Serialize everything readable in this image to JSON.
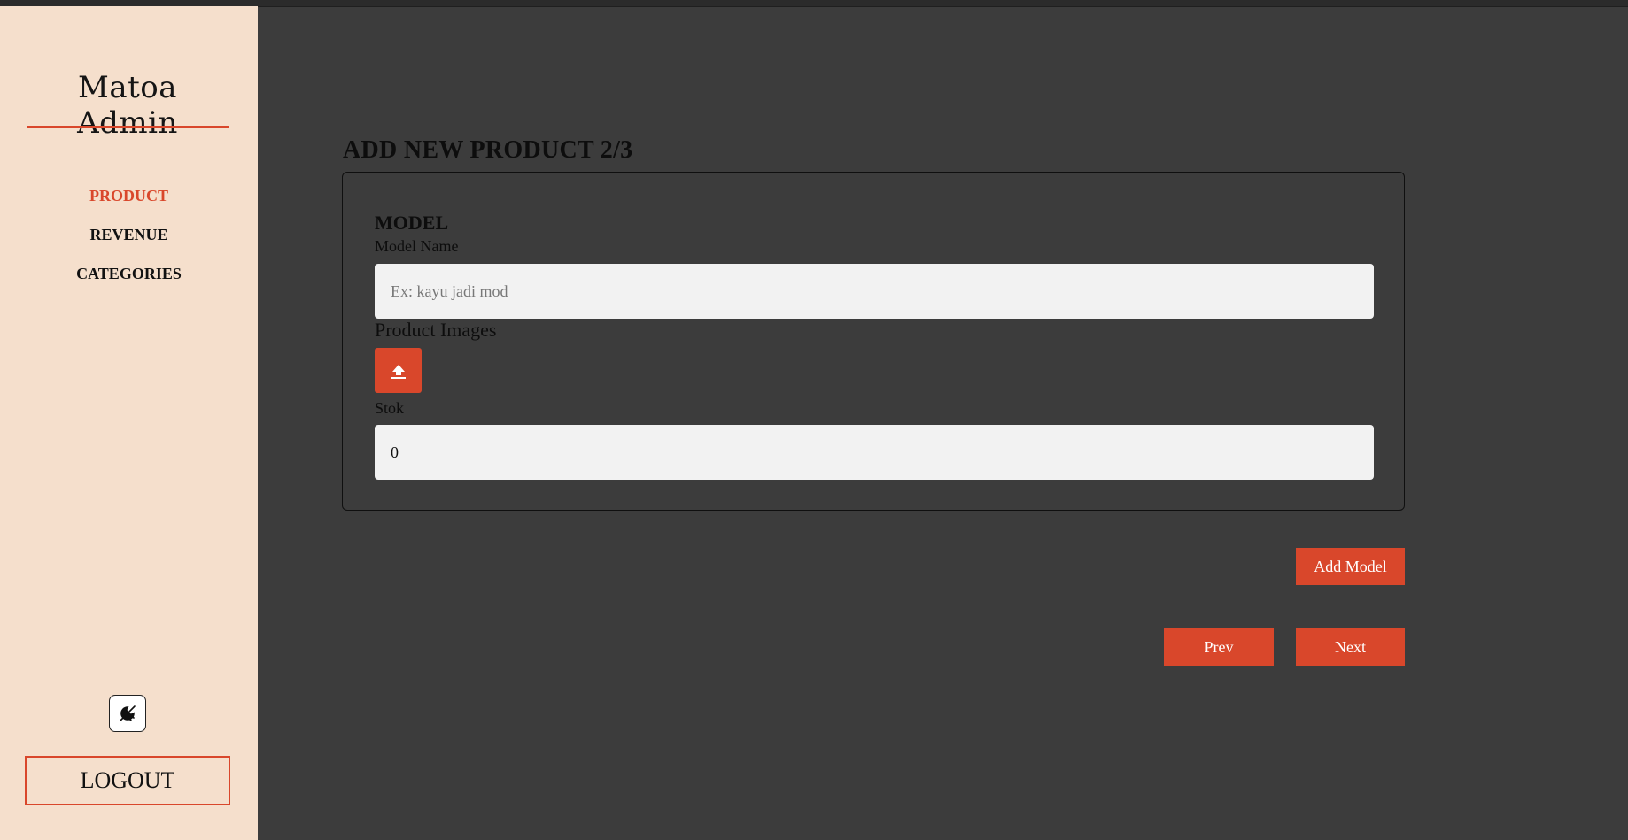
{
  "sidebar": {
    "brand": "Matoa Admin",
    "nav": [
      {
        "label": "PRODUCT",
        "active": true
      },
      {
        "label": "REVENUE",
        "active": false
      },
      {
        "label": "CATEGORIES",
        "active": false
      }
    ],
    "theme_toggle_icon": "dark-mode-toggle-icon",
    "logout_label": "LOGOUT"
  },
  "main": {
    "title": "ADD NEW PRODUCT 2/3",
    "section_title": "MODEL",
    "model_name_label": "Model Name",
    "model_name_placeholder": "Ex: kayu jadi mod",
    "model_name_value": "",
    "images_label": "Product Images",
    "upload_icon": "upload-icon",
    "stock_label": "Stok",
    "stock_value": "0",
    "add_model_label": "Add Model",
    "prev_label": "Prev",
    "next_label": "Next"
  },
  "colors": {
    "accent": "#d9472b",
    "sidebar_bg": "#f5dfcc",
    "main_bg": "#3c3c3c",
    "input_bg": "#f2f2f2"
  }
}
